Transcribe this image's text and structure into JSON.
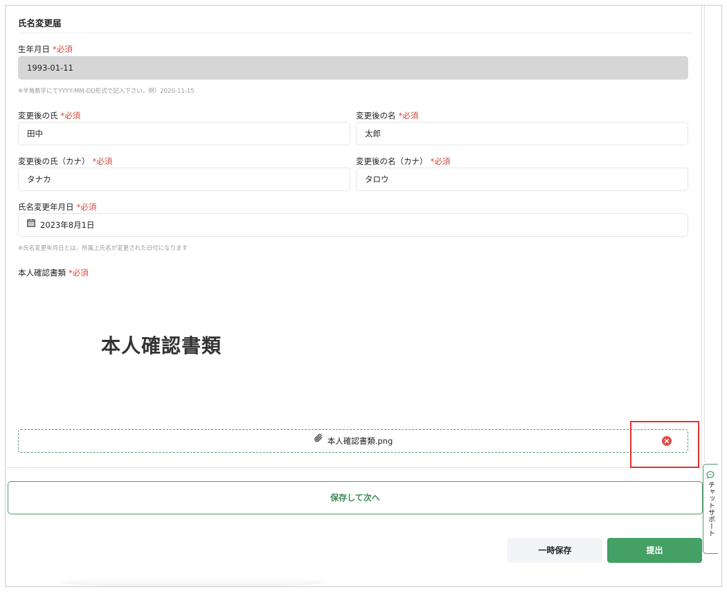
{
  "form": {
    "title": "氏名変更届",
    "required_mark": "*必須",
    "birthdate": {
      "label": "生年月日",
      "value": "1993-01-11",
      "hint": "※半角数字にてYYYY-MM-DD形式で記入下さい。例）2020-11-15"
    },
    "last_name": {
      "label": "変更後の氏",
      "value": "田中"
    },
    "first_name": {
      "label": "変更後の名",
      "value": "太郎"
    },
    "last_name_kana": {
      "label": "変更後の氏（カナ）",
      "value": "タナカ"
    },
    "first_name_kana": {
      "label": "変更後の名（カナ）",
      "value": "タロウ"
    },
    "change_date": {
      "label": "氏名変更年月日",
      "value": "2023年8月1日",
      "hint": "※氏名変更年月日とは、所属上氏名が変更された日付になります"
    },
    "id_document": {
      "label": "本人確認書類",
      "preview_text": "本人確認書類",
      "file_name": "本人確認書類.png"
    }
  },
  "actions": {
    "save_next": "保存して次へ",
    "temp_save": "一時保存",
    "submit": "提出"
  },
  "chat_support": {
    "label": "チャットサポート"
  },
  "colors": {
    "accent_green": "#44a065",
    "required_red": "#d0493c",
    "highlight_red": "#e3312a"
  }
}
